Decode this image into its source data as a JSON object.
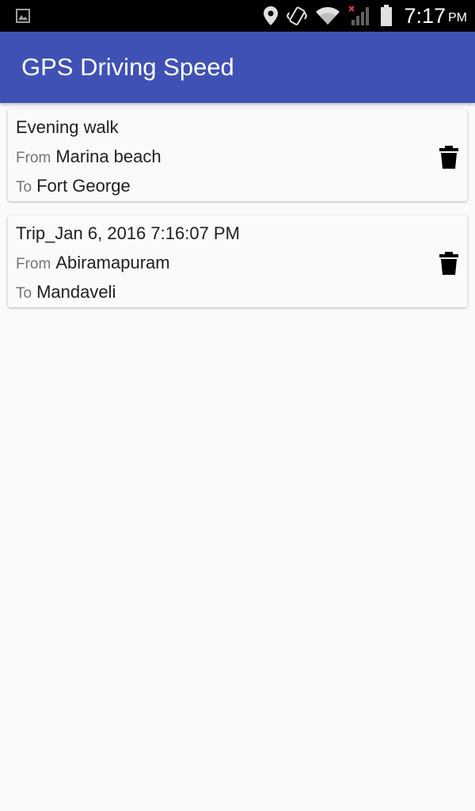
{
  "status_bar": {
    "time": "7:17",
    "ampm": "PM",
    "icons": [
      "gallery-notification-icon",
      "location-pin-icon",
      "vibrate-icon",
      "wifi-icon",
      "cellular-signal-icon",
      "battery-icon"
    ]
  },
  "app_bar": {
    "title": "GPS Driving Speed",
    "color": "#3f51b5"
  },
  "trips": [
    {
      "name": "Evening walk",
      "from_label": "From",
      "from": "Marina beach",
      "to_label": "To",
      "to": "Fort George",
      "delete_icon": "trash-icon"
    },
    {
      "name": "Trip_Jan 6, 2016 7:16:07 PM",
      "from_label": "From",
      "from": "Abiramapuram",
      "to_label": "To",
      "to": "Mandaveli",
      "delete_icon": "trash-icon"
    }
  ]
}
